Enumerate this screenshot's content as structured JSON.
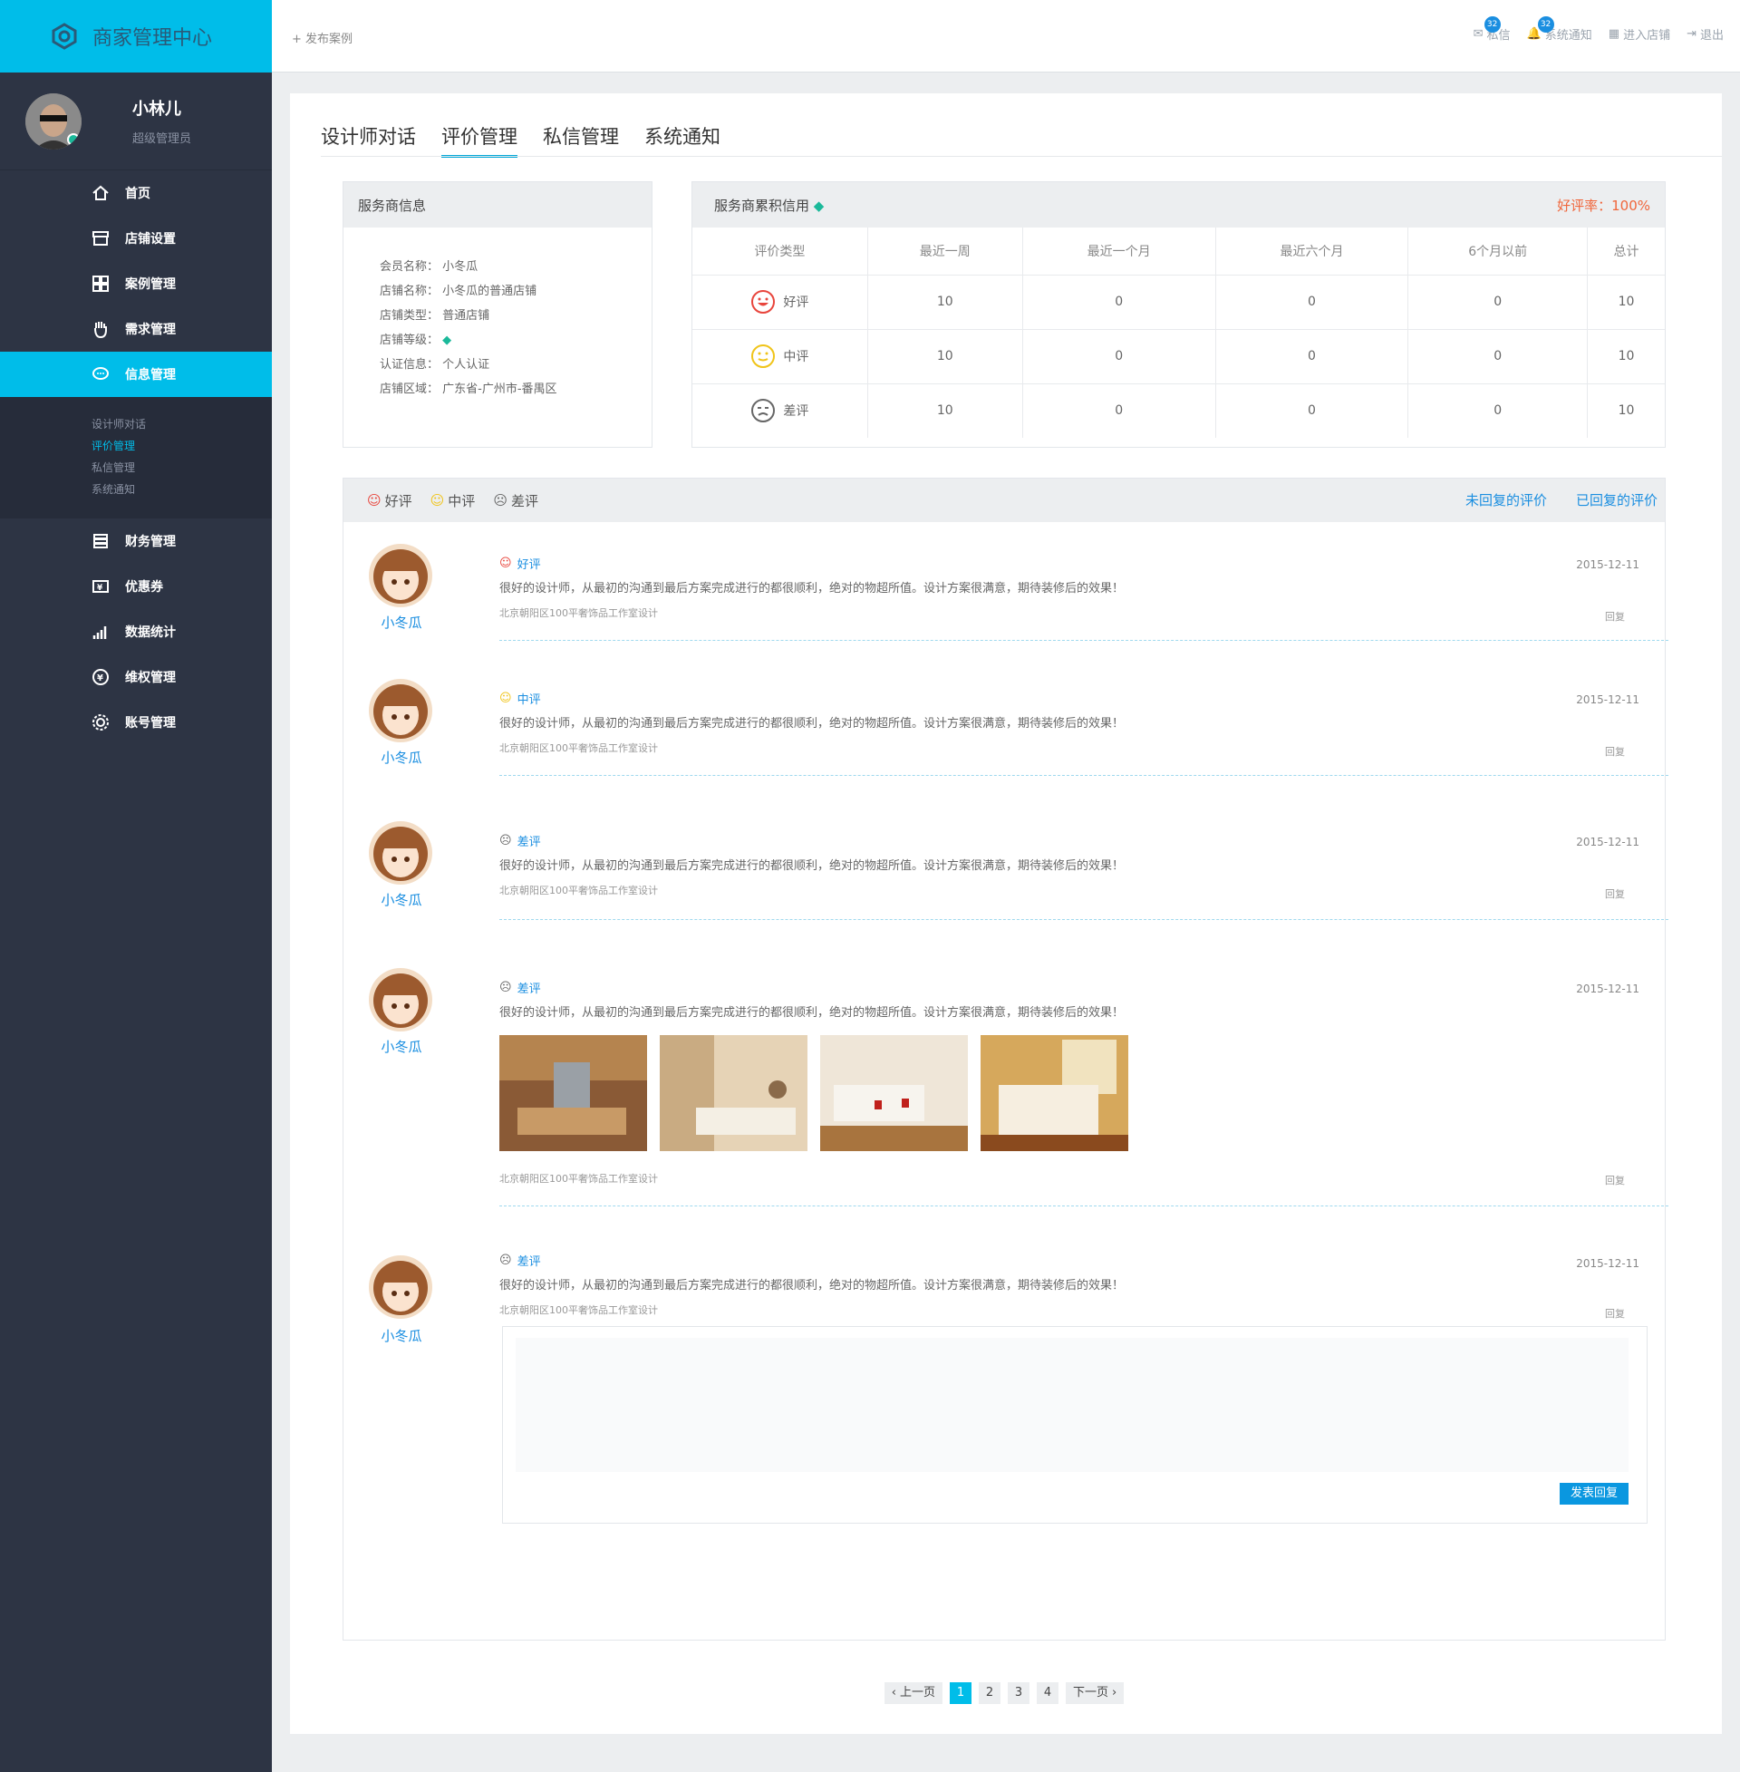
{
  "brand": {
    "title": "商家管理中心"
  },
  "profile": {
    "name": "小林儿",
    "role": "超级管理员"
  },
  "nav": [
    {
      "label": "首页",
      "icon": "home-icon"
    },
    {
      "label": "店铺设置",
      "icon": "store-icon"
    },
    {
      "label": "案例管理",
      "icon": "grid-icon"
    },
    {
      "label": "需求管理",
      "icon": "hand-icon"
    },
    {
      "label": "信息管理",
      "icon": "chat-icon",
      "active": true
    }
  ],
  "subnav": [
    "设计师对话",
    "评价管理",
    "私信管理",
    "系统通知"
  ],
  "nav2": [
    {
      "label": "财务管理",
      "icon": "coins-icon"
    },
    {
      "label": "优惠券",
      "icon": "coupon-icon"
    },
    {
      "label": "数据统计",
      "icon": "stats-icon"
    },
    {
      "label": "维权管理",
      "icon": "yen-icon"
    },
    {
      "label": "账号管理",
      "icon": "gear-icon"
    }
  ],
  "topbar": {
    "publish": "发布案例",
    "mail": "私信",
    "mail_count": "32",
    "notice": "系统通知",
    "notice_count": "32",
    "store": "进入店铺",
    "logout": "退出"
  },
  "tabs": [
    "设计师对话",
    "评价管理",
    "私信管理",
    "系统通知"
  ],
  "provider": {
    "title": "服务商信息",
    "rows": [
      {
        "k": "会员名称：",
        "v": "小冬瓜"
      },
      {
        "k": "店铺名称：",
        "v": "小冬瓜的普通店铺"
      },
      {
        "k": "店铺类型：",
        "v": "普通店铺"
      },
      {
        "k": "店铺等级：",
        "v": ""
      },
      {
        "k": "认证信息：",
        "v": "个人认证"
      },
      {
        "k": "店铺区域：",
        "v": "广东省-广州市-番禺区"
      }
    ]
  },
  "credit": {
    "title": "服务商累积信用",
    "rate": "好评率：100%",
    "headers": [
      "评价类型",
      "最近一周",
      "最近一个月",
      "最近六个月",
      "6个月以前",
      "总计"
    ],
    "rows": [
      {
        "type": "好评",
        "vals": [
          "10",
          "0",
          "0",
          "0",
          "10"
        ]
      },
      {
        "type": "中评",
        "vals": [
          "10",
          "0",
          "0",
          "0",
          "10"
        ]
      },
      {
        "type": "差评",
        "vals": [
          "10",
          "0",
          "0",
          "0",
          "10"
        ]
      }
    ]
  },
  "filters": {
    "good": "好评",
    "mid": "中评",
    "bad": "差评",
    "unreplied": "未回复的评价",
    "replied": "已回复的评价"
  },
  "reviews": [
    {
      "name": "小冬瓜",
      "type": "好评",
      "date": "2015-12-11",
      "text": "很好的设计师，从最初的沟通到最后方案完成进行的都很顺利，绝对的物超所值。设计方案很满意，期待装修后的效果！",
      "project": "北京朝阳区100平奢饰品工作室设计",
      "reply": "回复"
    },
    {
      "name": "小冬瓜",
      "type": "中评",
      "date": "2015-12-11",
      "text": "很好的设计师，从最初的沟通到最后方案完成进行的都很顺利，绝对的物超所值。设计方案很满意，期待装修后的效果！",
      "project": "北京朝阳区100平奢饰品工作室设计",
      "reply": "回复"
    },
    {
      "name": "小冬瓜",
      "type": "差评",
      "date": "2015-12-11",
      "text": "很好的设计师，从最初的沟通到最后方案完成进行的都很顺利，绝对的物超所值。设计方案很满意，期待装修后的效果！",
      "project": "北京朝阳区100平奢饰品工作室设计",
      "reply": "回复"
    },
    {
      "name": "小冬瓜",
      "type": "差评",
      "date": "2015-12-11",
      "text": "很好的设计师，从最初的沟通到最后方案完成进行的都很顺利，绝对的物超所值。设计方案很满意，期待装修后的效果！",
      "project": "北京朝阳区100平奢饰品工作室设计",
      "reply": "回复"
    },
    {
      "name": "小冬瓜",
      "type": "差评",
      "date": "2015-12-11",
      "text": "很好的设计师，从最初的沟通到最后方案完成进行的都很顺利，绝对的物超所值。设计方案很满意，期待装修后的效果！",
      "project": "北京朝阳区100平奢饰品工作室设计",
      "reply": "回复"
    }
  ],
  "reply_submit": "发表回复",
  "pager": {
    "prev": "上一页",
    "next": "下一页",
    "pages": [
      "1",
      "2",
      "3",
      "4"
    ]
  },
  "colors": {
    "accent": "#00bde9",
    "sidebar": "#2d3444",
    "link": "#1a8ee0",
    "rate": "#f0663b"
  }
}
